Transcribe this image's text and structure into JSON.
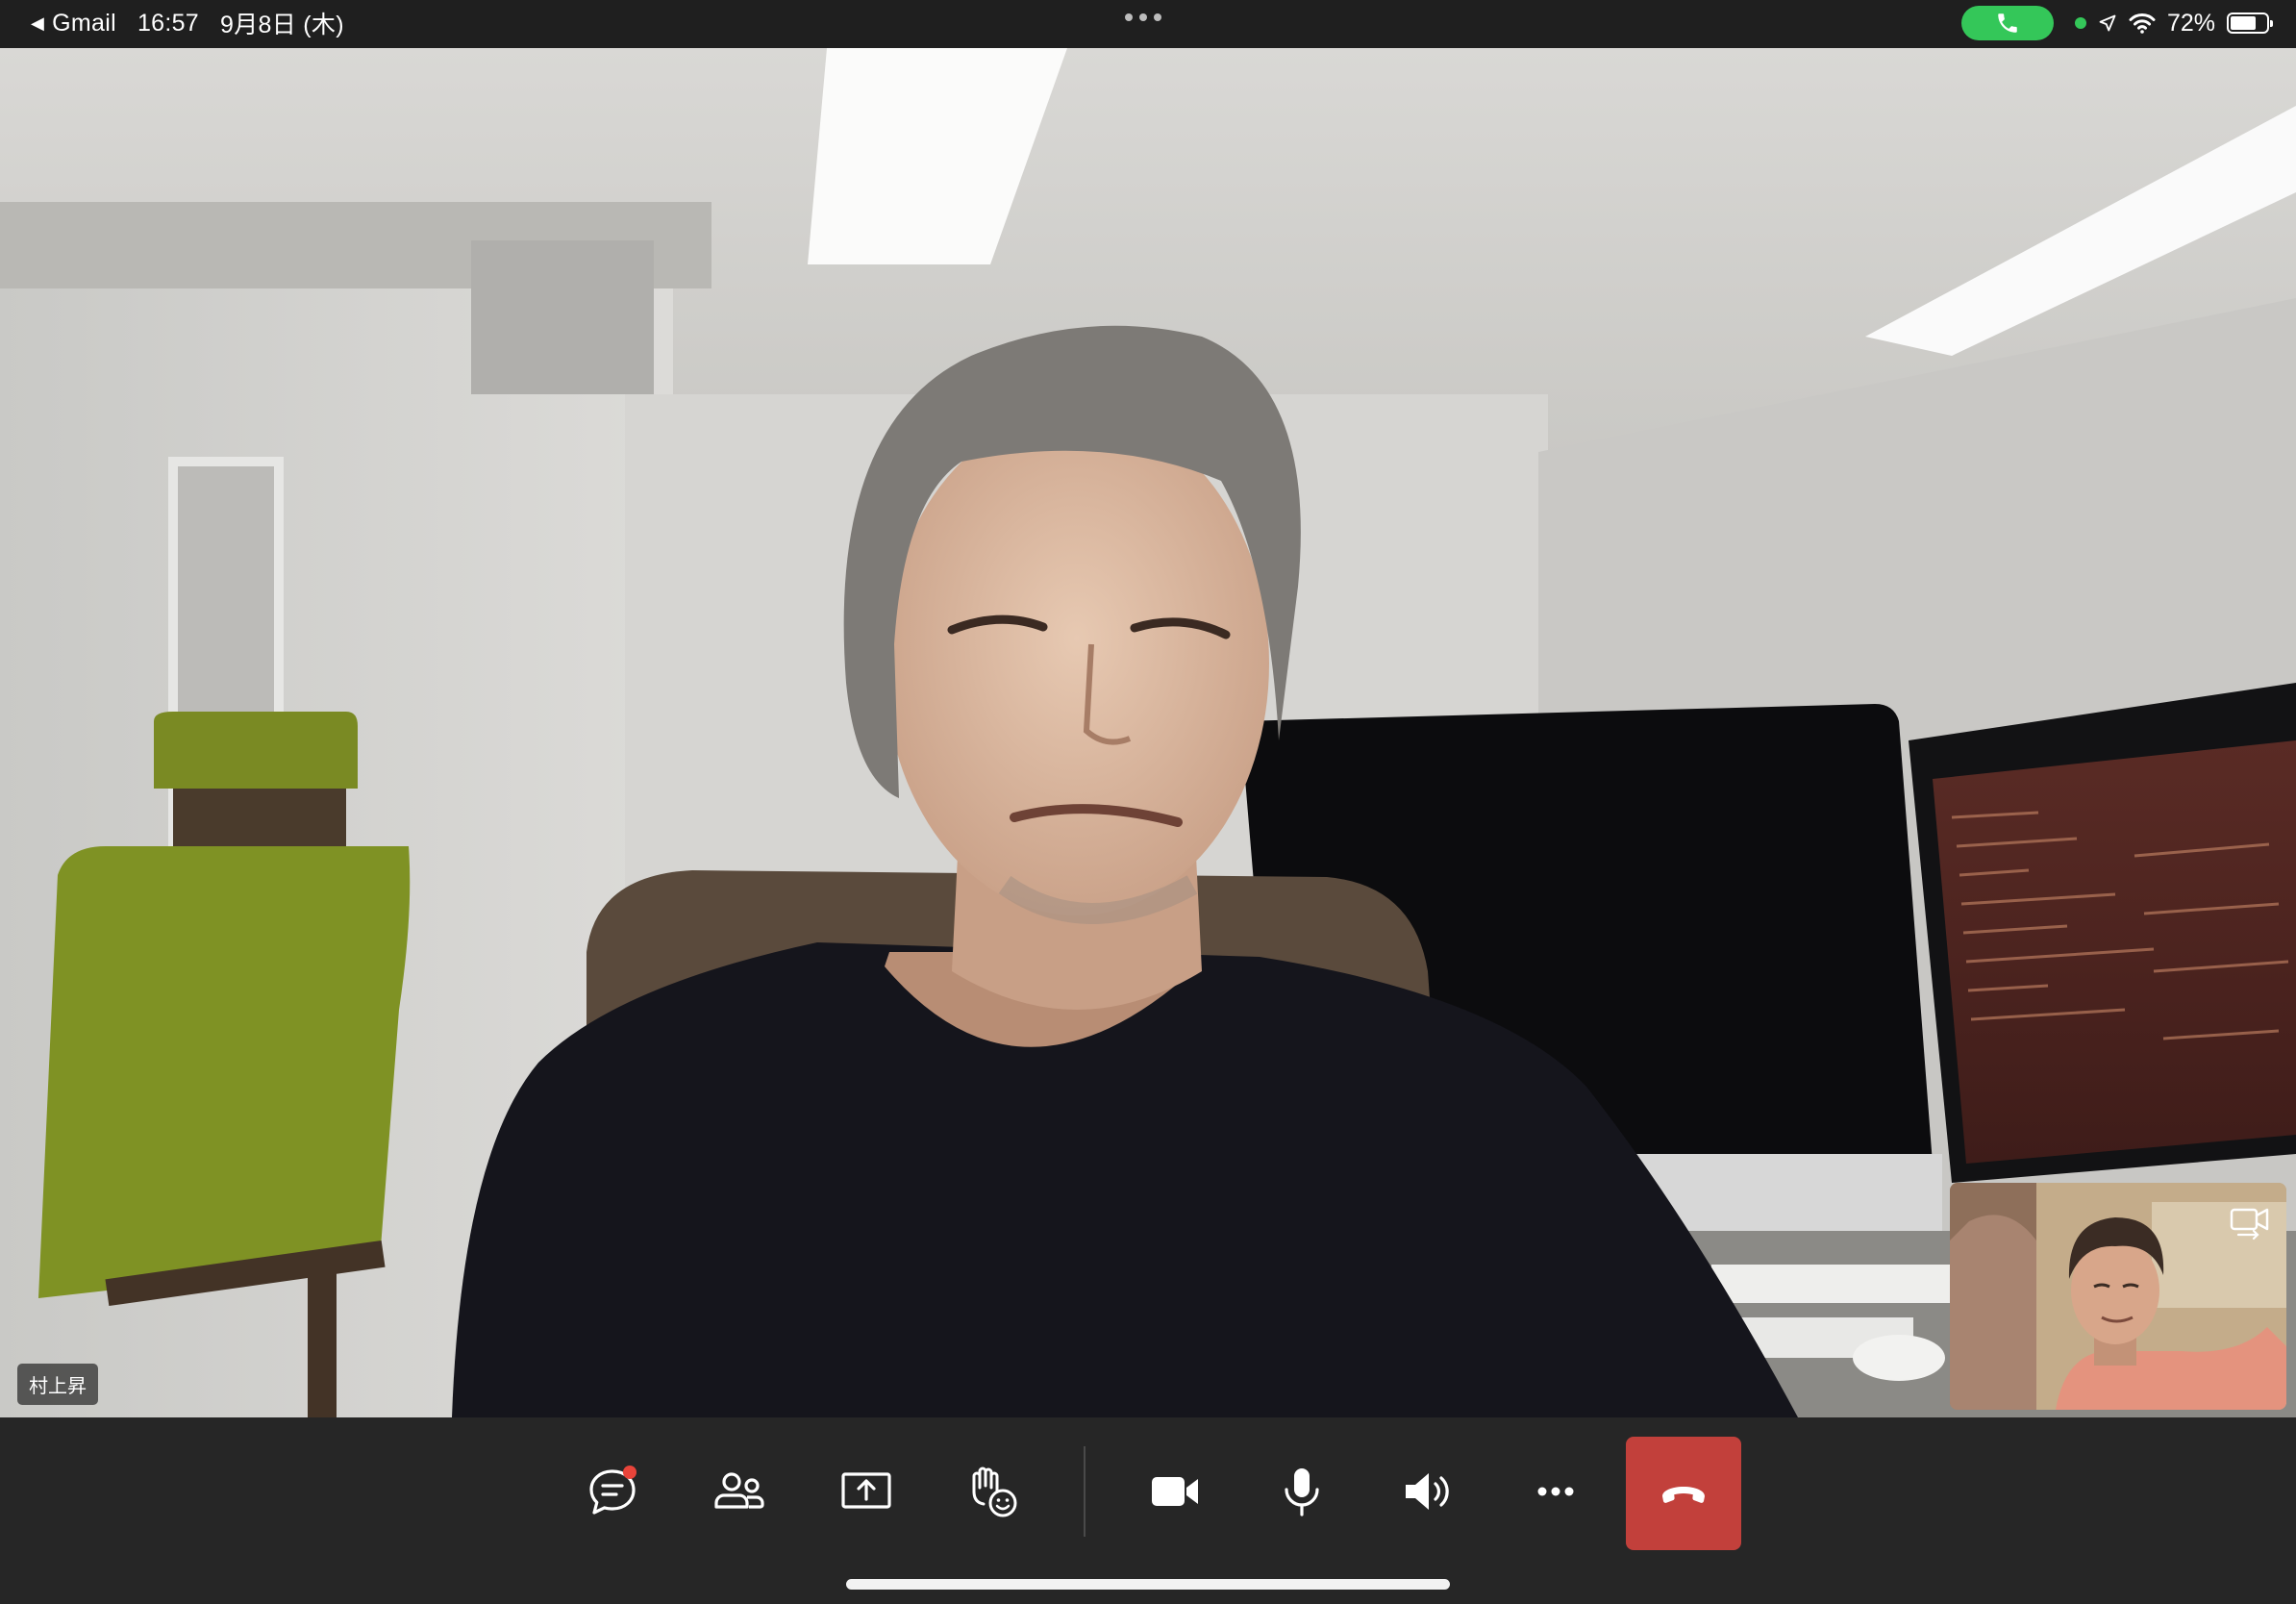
{
  "status_bar": {
    "back_app": "Gmail",
    "time": "16:57",
    "date": "9月8日 (木)",
    "battery_percent": "72%",
    "battery_level": 0.72
  },
  "main_video": {
    "participant_name": "村上昇"
  },
  "self_view": {
    "switch_camera_icon": "switch-camera-icon"
  },
  "controls": {
    "items": [
      {
        "name": "chat",
        "icon": "chat-icon",
        "has_badge": true
      },
      {
        "name": "participants",
        "icon": "people-icon"
      },
      {
        "name": "share",
        "icon": "share-screen-icon"
      },
      {
        "name": "reactions",
        "icon": "raise-hand-icon"
      },
      {
        "name": "camera",
        "icon": "video-camera-icon"
      },
      {
        "name": "microphone",
        "icon": "microphone-icon"
      },
      {
        "name": "speaker",
        "icon": "speaker-icon"
      },
      {
        "name": "more",
        "icon": "more-icon"
      },
      {
        "name": "hang-up",
        "icon": "hang-up-icon"
      }
    ]
  },
  "colors": {
    "hangup": "#c2403b",
    "call_pill": "#34c759",
    "badge": "#e8443a",
    "bar": "#262626"
  }
}
